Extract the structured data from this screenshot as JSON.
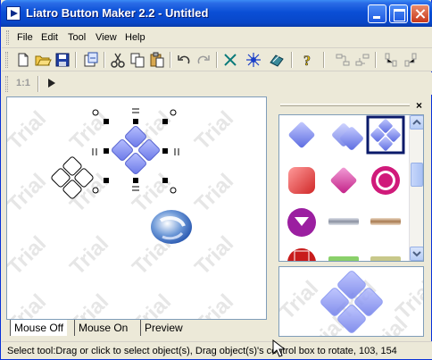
{
  "window": {
    "title": "Liatro Button Maker 2.2 - Untitled"
  },
  "menu": [
    "File",
    "Edit",
    "Tool",
    "View",
    "Help"
  ],
  "toolbar1": {
    "icons": [
      "new-file-icon",
      "open-folder-icon",
      "save-icon",
      "export-icon",
      "cut-icon",
      "copy-icon",
      "paste-icon",
      "undo-icon",
      "redo-icon",
      "select-tool-icon",
      "star-tool-icon",
      "fill-tool-icon",
      "help-icon",
      "align-left-icon",
      "align-right-icon",
      "align-top-icon",
      "align-bottom-icon"
    ]
  },
  "toolbar2": {
    "zoom_label": "1:1",
    "play_icon": "play-icon"
  },
  "watermark": "Trial",
  "tabs": [
    "Mouse Off",
    "Mouse On",
    "Preview"
  ],
  "active_tab": "Mouse Off",
  "gallery": {
    "close": "×",
    "items": [
      "blue-diamond",
      "blue-double-diamond",
      "blue-quad-diamond-selected",
      "red-rounded-square",
      "magenta-diamond",
      "magenta-ring",
      "magenta-down-circle",
      "gray-bar",
      "brown-bar",
      "red-circle-partial",
      "green-bar-partial",
      "olive-bar-partial"
    ]
  },
  "status": "Select tool:Drag or click to select object(s), Drag object(s)'s control box to rotate, 103, 154",
  "colors": {
    "titlebar": "#0a4fd6",
    "accent_blue": "#7f8ff0",
    "magenta": "#d63c9a",
    "chrome": "#ece9d8"
  }
}
